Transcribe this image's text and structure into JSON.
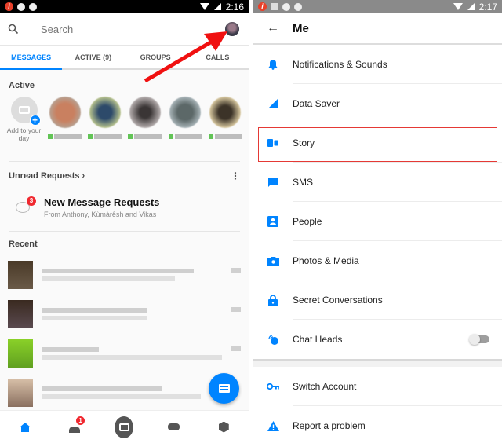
{
  "colors": {
    "accent": "#0084ff",
    "badge": "#f0282f",
    "highlight": "#e53935",
    "online": "#62c456"
  },
  "left": {
    "status": {
      "time": "2:16"
    },
    "search": {
      "placeholder": "Search",
      "icon": "search-icon"
    },
    "tabs": [
      {
        "label": "MESSAGES",
        "active": true
      },
      {
        "label": "ACTIVE (9)",
        "active": false
      },
      {
        "label": "GROUPS",
        "active": false
      },
      {
        "label": "CALLS",
        "active": false
      }
    ],
    "active_section": {
      "title": "Active",
      "add_label": "Add to your day"
    },
    "unread": {
      "title": "Unread Requests",
      "request_title": "New Message Requests",
      "request_subtitle": "From Anthony, Kùmàrêsh and Vikas",
      "badge_count": "3"
    },
    "recent": {
      "title": "Recent"
    },
    "bottom_nav": {
      "people_badge": "1"
    }
  },
  "right": {
    "status": {
      "time": "2:17"
    },
    "header": {
      "title": "Me",
      "back_icon": "back-arrow-icon"
    },
    "items": [
      {
        "label": "Notifications & Sounds",
        "icon": "bell-icon"
      },
      {
        "label": "Data Saver",
        "icon": "data-saver-icon"
      },
      {
        "label": "Story",
        "icon": "story-icon",
        "highlighted": true
      },
      {
        "label": "SMS",
        "icon": "sms-icon"
      },
      {
        "label": "People",
        "icon": "people-icon"
      },
      {
        "label": "Photos & Media",
        "icon": "camera-icon"
      },
      {
        "label": "Secret Conversations",
        "icon": "lock-icon"
      },
      {
        "label": "Chat Heads",
        "icon": "chat-heads-icon",
        "toggle": false
      }
    ],
    "items2": [
      {
        "label": "Switch Account",
        "icon": "key-icon"
      },
      {
        "label": "Report a problem",
        "icon": "warning-icon"
      }
    ]
  }
}
